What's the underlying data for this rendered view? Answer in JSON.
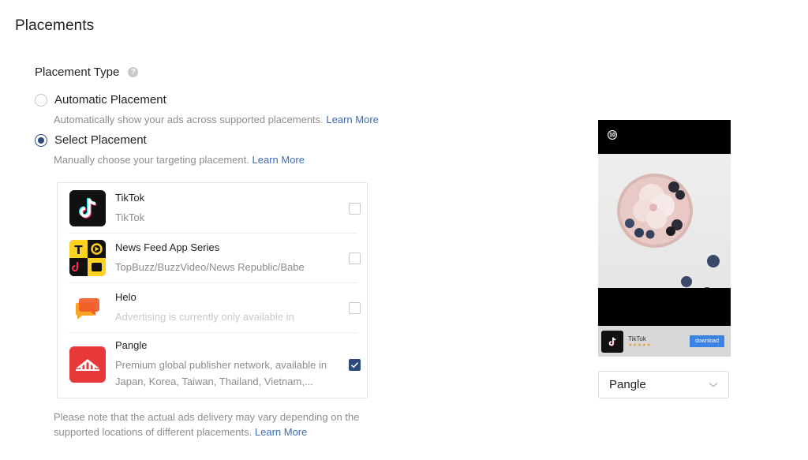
{
  "title": "Placements",
  "placement_type": {
    "label": "Placement Type",
    "help_icon": "?"
  },
  "options": [
    {
      "label": "Automatic Placement",
      "description": "Automatically show your ads across supported placements.",
      "link": "Learn More",
      "selected": false
    },
    {
      "label": "Select Placement",
      "description": "Manually choose your targeting placement.",
      "link": "Learn More",
      "selected": true
    }
  ],
  "placements": [
    {
      "name": "TikTok",
      "subtitle": "TikTok",
      "checked": false,
      "disabled": false
    },
    {
      "name": "News Feed App Series",
      "subtitle": "TopBuzz/BuzzVideo/News Republic/Babe",
      "checked": false,
      "disabled": false
    },
    {
      "name": "Helo",
      "subtitle": "Advertising is currently only available in",
      "checked": false,
      "disabled": true
    },
    {
      "name": "Pangle",
      "subtitle": "Premium global publisher network, available in Japan, Korea, Taiwan, Thailand, Vietnam,...",
      "checked": true,
      "disabled": false
    }
  ],
  "note": {
    "text": "Please note that the actual ads delivery may vary depending on the supported locations of different placements.",
    "link": "Learn More"
  },
  "preview": {
    "badge": "10",
    "app_name": "TikTok",
    "rating_stars": "★★★★★",
    "download_label": "download"
  },
  "preview_select": {
    "value": "Pangle"
  },
  "colors": {
    "accent": "#2d4a7e",
    "link": "#3d6bb3",
    "muted_text": "#8d8d8d",
    "download_button": "#3b82e5"
  }
}
